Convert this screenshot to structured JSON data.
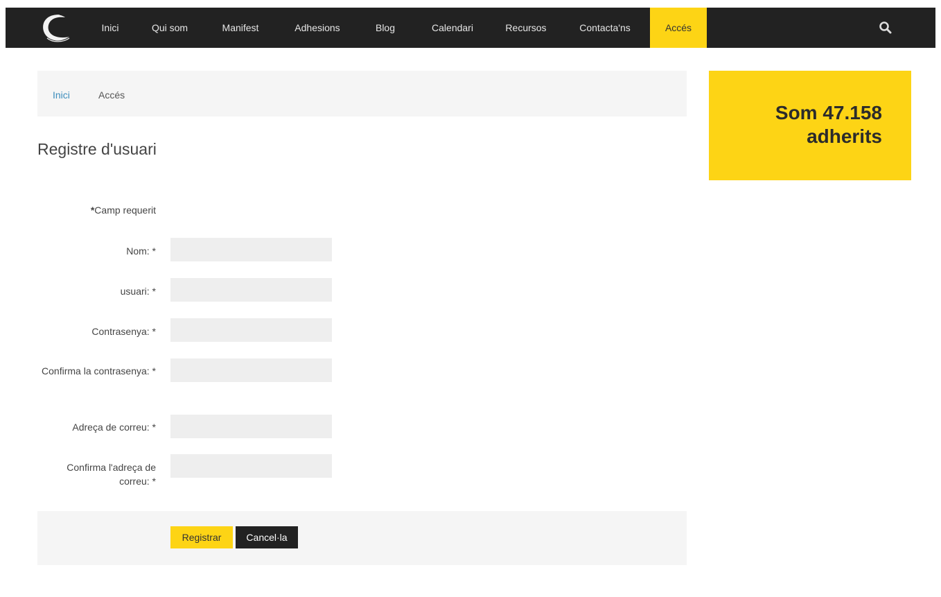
{
  "nav": {
    "items": [
      {
        "label": "Inici"
      },
      {
        "label": "Qui som"
      },
      {
        "label": "Manifest"
      },
      {
        "label": "Adhesions"
      },
      {
        "label": "Blog"
      },
      {
        "label": "Calendari"
      },
      {
        "label": "Recursos"
      },
      {
        "label": "Contacta'ns"
      },
      {
        "label": "Accés",
        "active": true
      }
    ],
    "active_color": "#fdd415",
    "background": "#222222",
    "logo_icon": "crescent-logo-icon",
    "search_icon": "search-icon"
  },
  "breadcrumb": {
    "home": "Inici",
    "current": "Accés"
  },
  "sidebar": {
    "members_line1": "Som 47.158",
    "members_line2": "adherits"
  },
  "page": {
    "title": "Registre d'usuari"
  },
  "form": {
    "required_star": "*",
    "required_note": "Camp requerit",
    "fields": [
      {
        "label": "Nom: *",
        "value": ""
      },
      {
        "label": "usuari: *",
        "value": ""
      },
      {
        "label": "Contrasenya: *",
        "value": ""
      },
      {
        "label": "Confirma la contrasenya: *",
        "value": ""
      },
      {
        "label": "Adreça de correu: *",
        "value": ""
      },
      {
        "label": "Confirma l'adreça de correu: *",
        "value": ""
      }
    ],
    "register_label": "Registrar",
    "cancel_label": "Cancel·la"
  }
}
